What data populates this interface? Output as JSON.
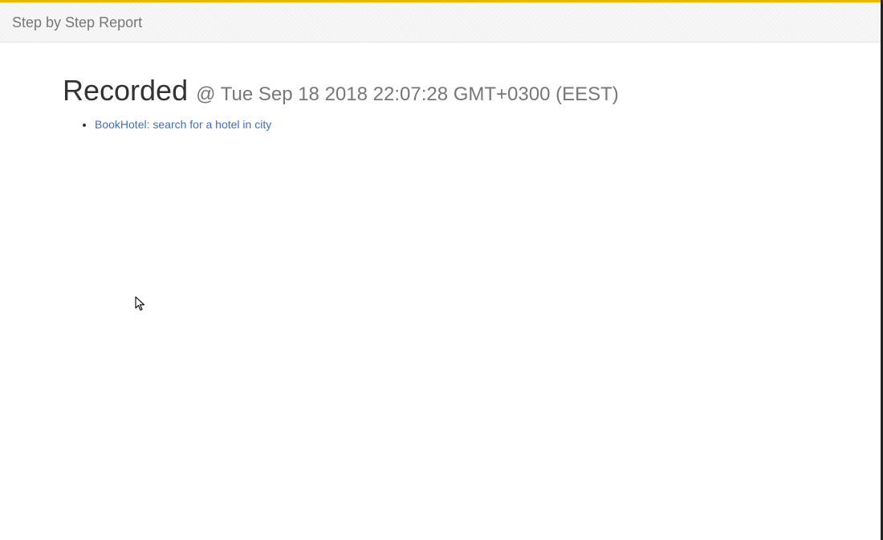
{
  "navbar": {
    "brand": "Step by Step Report"
  },
  "report": {
    "title": "Recorded",
    "timestamp": "@ Tue Sep 18 2018 22:07:28 GMT+0300 (EEST)",
    "scenarios": [
      {
        "label": "BookHotel: search for a hotel in city"
      }
    ]
  },
  "colors": {
    "accent": "#f0b400",
    "link": "#3f6fbf",
    "muted": "#777777"
  },
  "icons": {
    "cursor": "mouse-pointer-icon"
  }
}
